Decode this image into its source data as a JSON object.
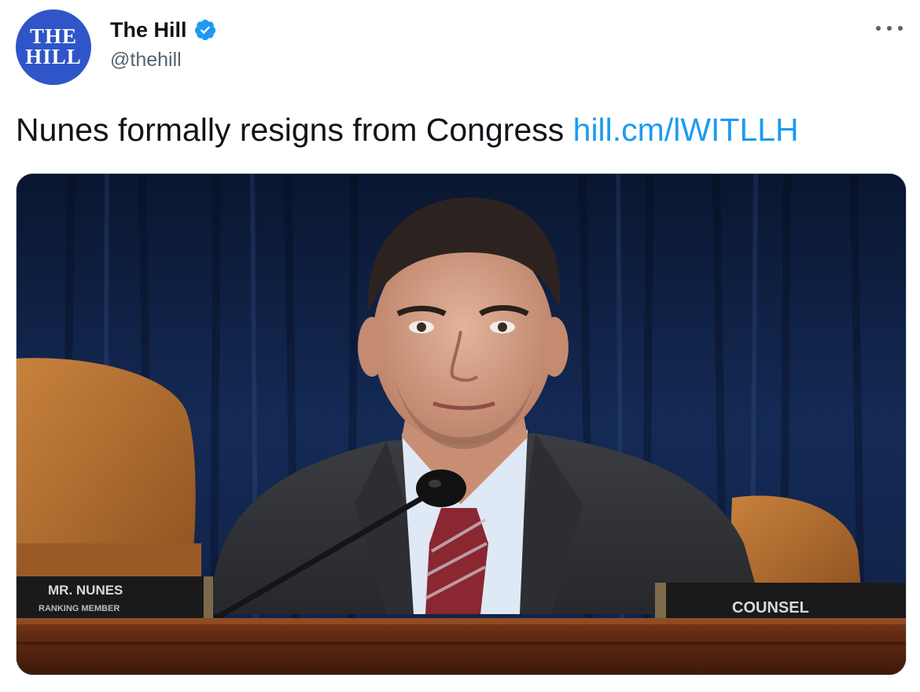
{
  "account": {
    "avatar_text": "THE HILL",
    "avatar_line1": "THE",
    "avatar_line2": "HILL",
    "display_name": "The Hill",
    "handle": "@thehill",
    "verified": true
  },
  "tweet": {
    "text": "Nunes formally resigns from Congress ",
    "link": "hill.cm/lWITLLH"
  },
  "photo": {
    "nameplate_left_line1": "MR. NUNES",
    "nameplate_left_line2": "RANKING MEMBER",
    "nameplate_right": "COUNSEL"
  },
  "colors": {
    "brand_blue": "#2f55c8",
    "link_blue": "#1d9bf0",
    "verified_blue": "#1d9bf0",
    "text_primary": "#0f1419",
    "text_secondary": "#536471",
    "border": "#cfd9de"
  },
  "icons": {
    "verified": "verified-badge-icon",
    "more": "more-options-icon"
  }
}
